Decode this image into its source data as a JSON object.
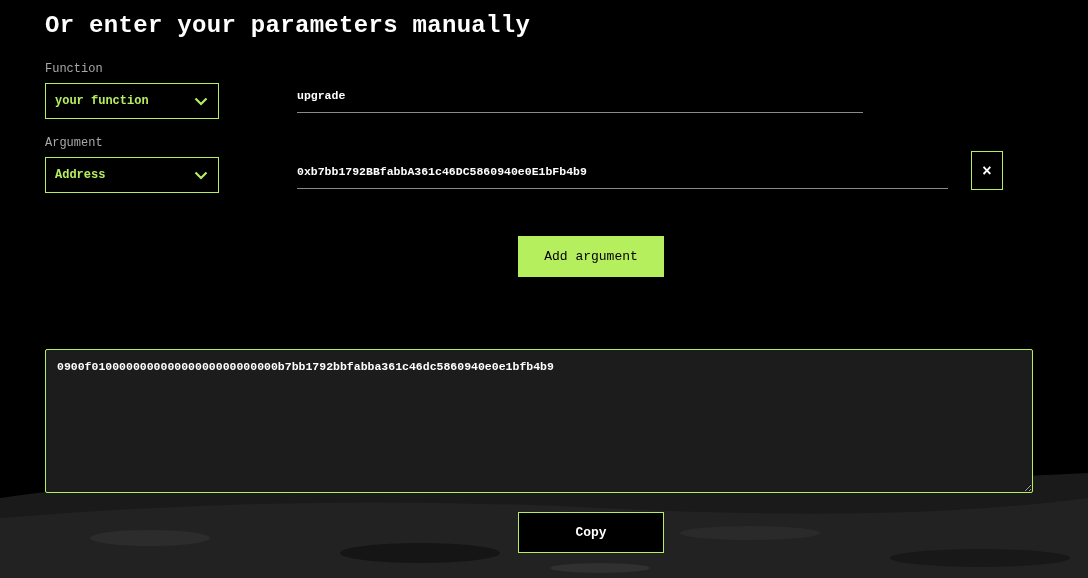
{
  "heading": "Or enter your parameters manually",
  "function": {
    "label": "Function",
    "selected_value": "your function",
    "input_value": "upgrade"
  },
  "arguments": [
    {
      "label": "Argument",
      "selected_value": "Address",
      "input_value": "0xb7bb1792BBfabbA361c46DC5860940e0E1bFb4b9",
      "remove_button": "×"
    }
  ],
  "add_argument_button": "Add argument",
  "output": {
    "value": "0900f010000000000000000000000000b7bb1792bbfabba361c46dc5860940e0e1bfb4b9"
  },
  "copy_button": "Copy"
}
